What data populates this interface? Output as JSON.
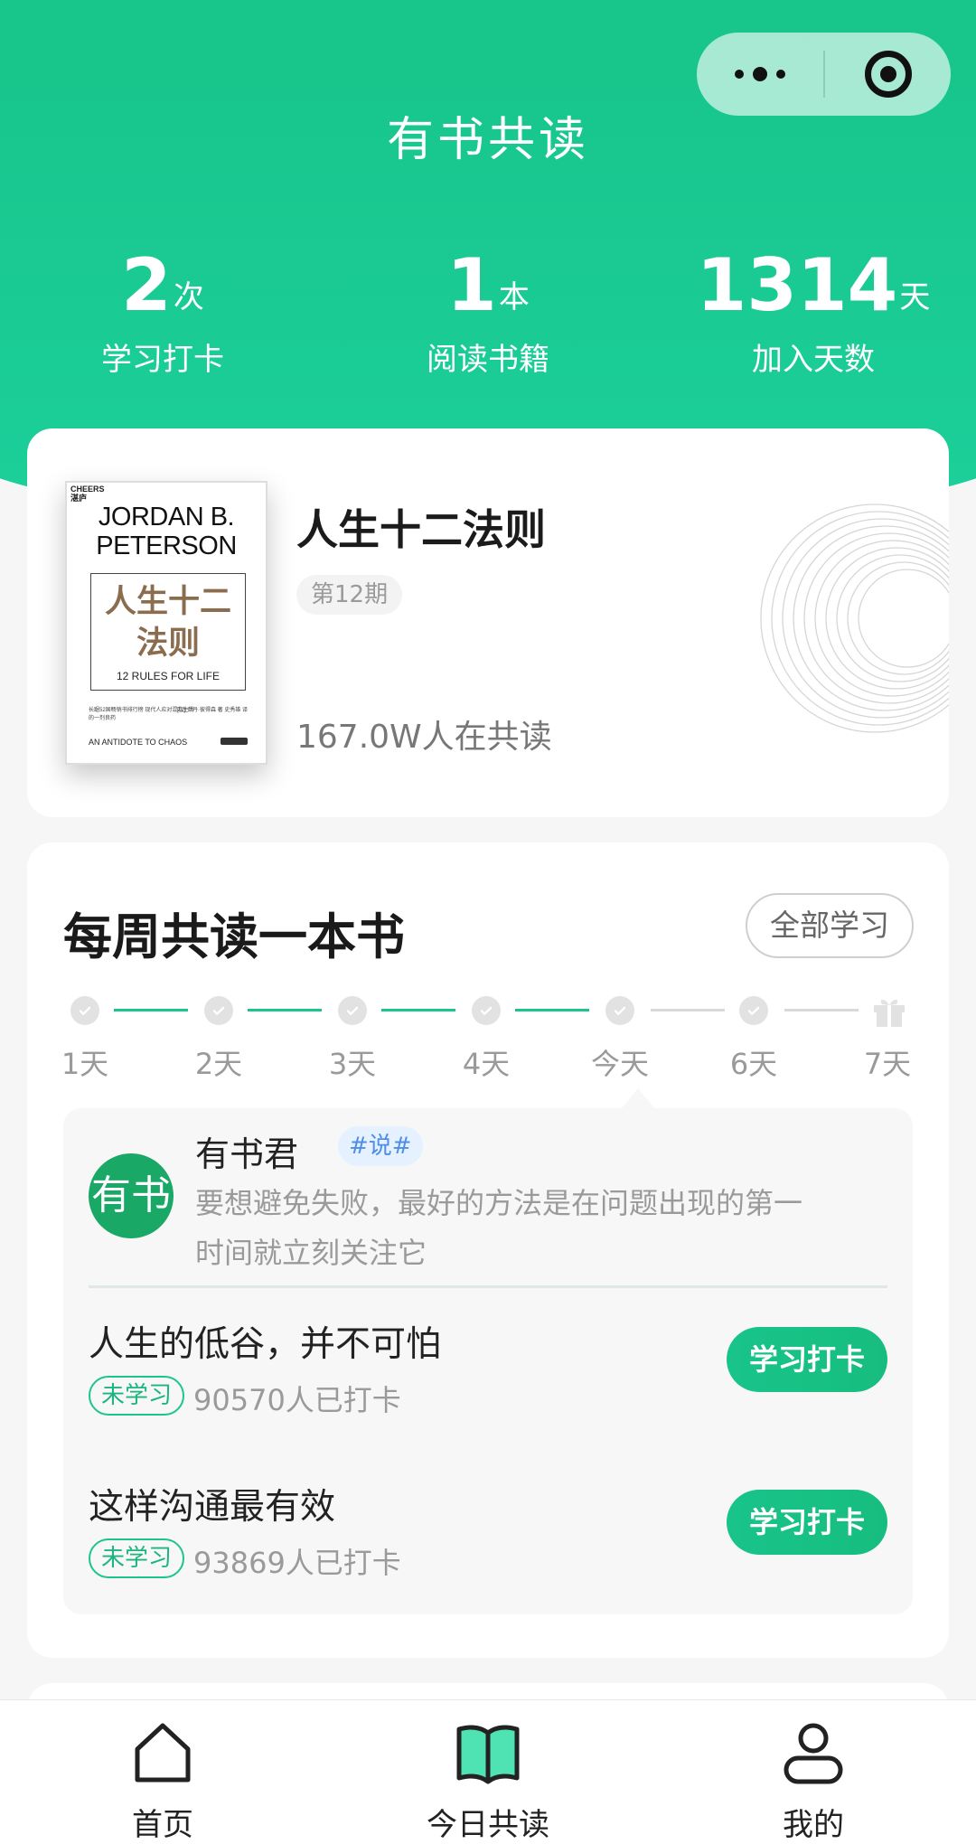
{
  "app": {
    "title": "有书共读"
  },
  "stats": [
    {
      "value": "2",
      "unit": "次",
      "label": "学习打卡"
    },
    {
      "value": "1",
      "unit": "本",
      "label": "阅读书籍"
    },
    {
      "value": "1314",
      "unit": "天",
      "label": "加入天数"
    }
  ],
  "book": {
    "title": "人生十二法则",
    "issue": "第12期",
    "readers": "167.0W人在共读",
    "cover": {
      "publisher": "CHEERS 湛庐",
      "author": "JORDAN B. PETERSON",
      "title_zh": "人生十二法则",
      "title_en": "12 RULES FOR LIFE",
      "tagline": "长踞52国畅销书排行榜 现代人应对混乱生活的一剂良药",
      "credits": "[加] 乔丹·彼得森 著 史秀雄 译",
      "subtitle": "AN ANTIDOTE TO CHAOS"
    }
  },
  "weekly": {
    "title": "每周共读一本书",
    "all_button": "全部学习",
    "days": [
      "1天",
      "2天",
      "3天",
      "4天",
      "今天",
      "6天",
      "7天"
    ],
    "quote": {
      "avatar_text": "有书",
      "name": "有书君",
      "tag": "#说#",
      "text": "要想避免失败，最好的方法是在问题出现的第一时间就立刻关注它"
    },
    "lessons": [
      {
        "title": "人生的低谷，并不可怕",
        "badge": "未学习",
        "count": "90570人已打卡",
        "button": "学习打卡"
      },
      {
        "title": "这样沟通最有效",
        "badge": "未学习",
        "count": "93869人已打卡",
        "button": "学习打卡"
      }
    ]
  },
  "tabbar": {
    "items": [
      {
        "label": "首页",
        "icon": "home-icon"
      },
      {
        "label": "今日共读",
        "icon": "open-book-icon"
      },
      {
        "label": "我的",
        "icon": "user-icon"
      }
    ]
  },
  "colors": {
    "accent": "#1cc58d",
    "header": "#17c489",
    "tag_blue": "#4f8ee8"
  }
}
